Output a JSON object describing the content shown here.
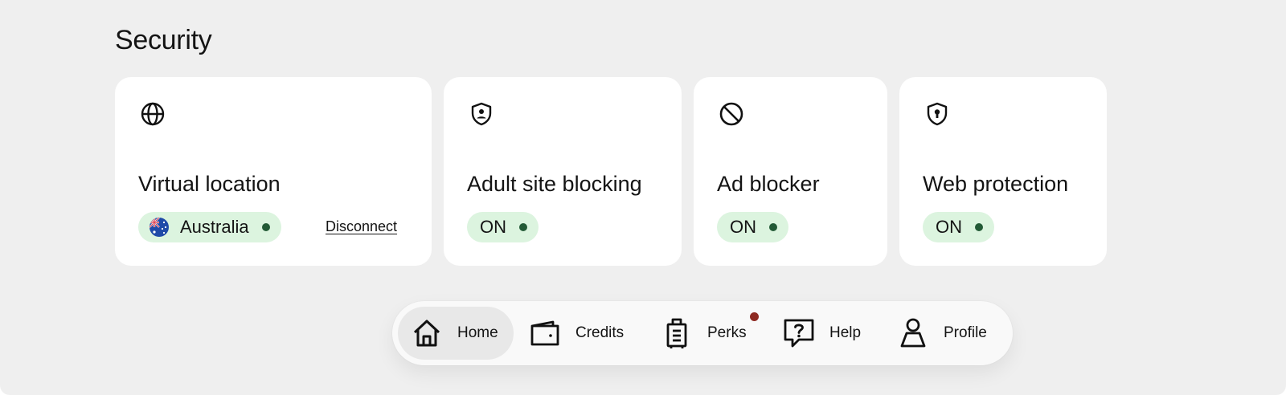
{
  "section": {
    "title": "Security"
  },
  "cards": {
    "virtual_location": {
      "title": "Virtual location",
      "icon": "globe-icon",
      "location": "Australia",
      "flag_icon": "australia-flag-icon",
      "disconnect_label": "Disconnect"
    },
    "adult_site_blocking": {
      "title": "Adult site blocking",
      "icon": "shield-person-icon",
      "status": "ON"
    },
    "ad_blocker": {
      "title": "Ad blocker",
      "icon": "block-icon",
      "status": "ON"
    },
    "web_protection": {
      "title": "Web protection",
      "icon": "shield-keyhole-icon",
      "status": "ON"
    }
  },
  "nav": {
    "items": [
      {
        "label": "Home",
        "icon": "home-icon",
        "active": true
      },
      {
        "label": "Credits",
        "icon": "wallet-icon",
        "active": false
      },
      {
        "label": "Perks",
        "icon": "luggage-icon",
        "active": false,
        "badge": true
      },
      {
        "label": "Help",
        "icon": "help-bubble-icon",
        "active": false
      },
      {
        "label": "Profile",
        "icon": "profile-icon",
        "active": false
      }
    ]
  },
  "colors": {
    "background": "#efefef",
    "card": "#ffffff",
    "status_pill": "#dcf4df",
    "status_dot": "#235a36",
    "nav_active": "#e8e8e8",
    "badge": "#8e2a22"
  }
}
